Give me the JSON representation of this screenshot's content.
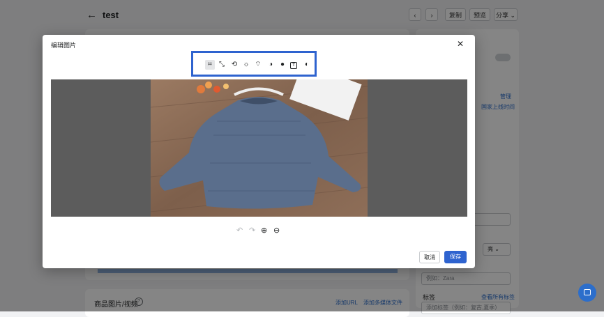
{
  "page": {
    "title": "test",
    "back_icon": "←",
    "nav_prev": "‹",
    "nav_next": "›",
    "duplicate": "复制",
    "preview": "预览",
    "share": "分享 ⌄",
    "right_panel": {
      "manage": "管理",
      "sales_channel_time": "国家上线时间",
      "tags_label": "标签",
      "manage_all_tags": "查看所有标签",
      "vendor_placeholder": "例如：Zara",
      "tags_placeholder": "添加标签（例如：复古,夏季）",
      "status_select": "亮 ⌄"
    },
    "media": {
      "title": "商品图片/视频",
      "help": "?",
      "add_url": "添加URL",
      "add_media": "添加多媒体文件"
    }
  },
  "modal": {
    "title": "编辑图片",
    "close": "✕",
    "tools": [
      {
        "name": "crop-icon",
        "glyph": "⌗",
        "active": true
      },
      {
        "name": "resize-icon",
        "glyph": "⤡",
        "active": false
      },
      {
        "name": "rotate-icon",
        "glyph": "⟲",
        "active": false
      },
      {
        "name": "brightness-icon",
        "glyph": "☼",
        "active": false
      },
      {
        "name": "draw-icon",
        "glyph": "⌔",
        "active": false
      },
      {
        "name": "contrast-icon",
        "glyph": "◑",
        "active": false
      },
      {
        "name": "saturation-icon",
        "glyph": "●",
        "active": false
      },
      {
        "name": "text-icon",
        "glyph": "T",
        "active": false
      },
      {
        "name": "filter-icon",
        "glyph": "◐",
        "active": false
      }
    ],
    "undo": "↶",
    "redo": "↷",
    "zoom_in": "⊕",
    "zoom_out": "⊖",
    "cancel": "取消",
    "save": "保存"
  },
  "colors": {
    "accent": "#2e63cf",
    "highlight_box": "#2e63cf"
  }
}
